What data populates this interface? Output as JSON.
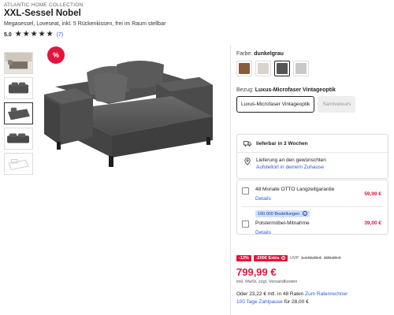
{
  "product": {
    "brand": "ATLANTIC HOME COLLECTION",
    "title": "XXL-Sessel Nobel",
    "subtitle": "Megasessel, Loveseat, inkl. 5 Rückenkissen, frei im Raum stellbar",
    "rating": {
      "score": "5.0",
      "count": "(7)",
      "stars": 5
    }
  },
  "sale_badge": "%",
  "color": {
    "label": "Farbe:",
    "selected": "dunkelgrau",
    "swatches": [
      {
        "name": "braun",
        "hex": "#8a5a3c"
      },
      {
        "name": "beige",
        "hex": "#d9d3cb"
      },
      {
        "name": "dunkelgrau",
        "hex": "#555555"
      },
      {
        "name": "hellgrau",
        "hex": "#c8c8c8"
      }
    ]
  },
  "cover": {
    "label": "Bezug:",
    "selected": "Luxus-Microfaser Vintageoptik",
    "options": [
      "Luxus-Microfaser Vintageoptik",
      "Samtvelours"
    ]
  },
  "delivery": {
    "availability": "lieferbar in 3 Wochen",
    "delivery_text": "Lieferung an den gewünschten",
    "delivery_link": "Aufstellort in deinem Zuhause"
  },
  "services": [
    {
      "title": "48 Monate OTTO Langzeitgarantie",
      "price": "59,99 €",
      "details": "Details",
      "badge": ""
    },
    {
      "title": "Polstermöbel-Mitnahme",
      "price": "39,00 €",
      "details": "Details",
      "badge": "100.000 Bestellungen"
    }
  ],
  "pricing": {
    "discount_tag": "-13%",
    "extra_tag": "-200€ Extra",
    "uvp_label": "UVP",
    "uvp_price": "1.149,00 €",
    "old_price": "999,99 €",
    "price": "799,99 €",
    "price_note": "inkl. MwSt. zzgl. Versandkosten",
    "installment_text": "Oder 23,22 € mtl. in 48 Raten",
    "installment_link": "Zum Ratenrechner",
    "zahlpause_link": "100 Tage Zahlpause",
    "zahlpause_text": "für 28,00 €"
  },
  "colors": {
    "accent": "#e3143d",
    "link": "#2a5dd6",
    "sofa": "#5c5c5c"
  }
}
